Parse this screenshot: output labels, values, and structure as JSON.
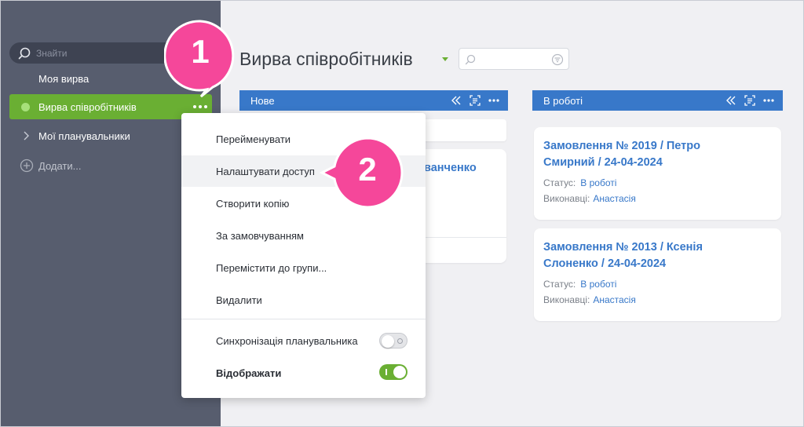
{
  "sidebar": {
    "search_placeholder": "Знайти",
    "items": [
      {
        "label": "Моя вирва"
      },
      {
        "label": "Вирва співробітників"
      },
      {
        "label": "Мої планувальники"
      },
      {
        "label": "Додати..."
      }
    ]
  },
  "board": {
    "title": "Вирва співробітників",
    "columns": [
      {
        "label": "Нове"
      },
      {
        "label": "В роботі"
      }
    ],
    "hidden_card_fragment": "ванченко",
    "cards": [
      {
        "title": "Замовлення № 2019 / Петро Смирний / 24-04-2024",
        "status_label": "Статус:",
        "status_value": "В роботі",
        "assignee_label": "Виконавці:",
        "assignee_value": "Анастасія"
      },
      {
        "title": "Замовлення № 2013 / Ксенія Слоненко / 24-04-2024",
        "status_label": "Статус:",
        "status_value": "В роботі",
        "assignee_label": "Виконавці:",
        "assignee_value": "Анастасія"
      }
    ]
  },
  "context_menu": {
    "items": [
      {
        "label": "Перейменувати"
      },
      {
        "label": "Налаштувати доступ"
      },
      {
        "label": "Створити копію"
      },
      {
        "label": "За замовчуванням"
      },
      {
        "label": "Перемістити до групи..."
      },
      {
        "label": "Видалити"
      }
    ],
    "toggles": [
      {
        "label": "Синхронізація планувальника",
        "on": false
      },
      {
        "label": "Відображати",
        "on": true
      }
    ]
  },
  "callouts": [
    {
      "number": "1"
    },
    {
      "number": "2"
    }
  ],
  "colors": {
    "sidebar": "#575d6e",
    "accent_green": "#6aaf33",
    "column_blue": "#3878c9",
    "callout_pink": "#f5479a"
  }
}
